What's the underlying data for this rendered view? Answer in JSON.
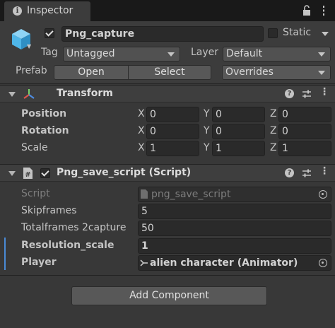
{
  "tab": {
    "label": "Inspector"
  },
  "gameobject": {
    "name": "Png_capture",
    "static_label": "Static",
    "tag_label": "Tag",
    "tag_value": "Untagged",
    "layer_label": "Layer",
    "layer_value": "Default",
    "prefab_label": "Prefab",
    "open_label": "Open",
    "select_label": "Select",
    "overrides_label": "Overrides"
  },
  "transform": {
    "title": "Transform",
    "rows": [
      {
        "label": "Position",
        "x": "0",
        "y": "0",
        "z": "0"
      },
      {
        "label": "Rotation",
        "x": "0",
        "y": "0",
        "z": "0"
      },
      {
        "label": "Scale",
        "x": "1",
        "y": "1",
        "z": "1"
      }
    ],
    "axis": {
      "x": "X",
      "y": "Y",
      "z": "Z"
    }
  },
  "script_component": {
    "title": "Png_save_script (Script)",
    "script_label": "Script",
    "script_value": "png_save_script",
    "fields": [
      {
        "label": "Skipframes",
        "value": "5"
      },
      {
        "label": "Totalframes 2capture",
        "value": "50"
      },
      {
        "label": "Resolution_scale",
        "value": "1"
      },
      {
        "label": "Player",
        "value": "alien character (Animator)"
      }
    ]
  },
  "add_component_label": "Add Component",
  "icons": {
    "tab": "info-icon",
    "lock": "lock-icon",
    "menu": "kebab-menu-icon",
    "gameobject": "cube-icon",
    "transform": "transform-axes-icon",
    "script": "script-hash-icon",
    "help": "help-icon",
    "presets": "sliders-icon",
    "more": "more-dots-icon",
    "target": "object-picker-icon",
    "animator": "animator-icon"
  },
  "colors": {
    "accent": "#4a8bd6",
    "background": "#383838",
    "cube": "#4fb6e8"
  }
}
